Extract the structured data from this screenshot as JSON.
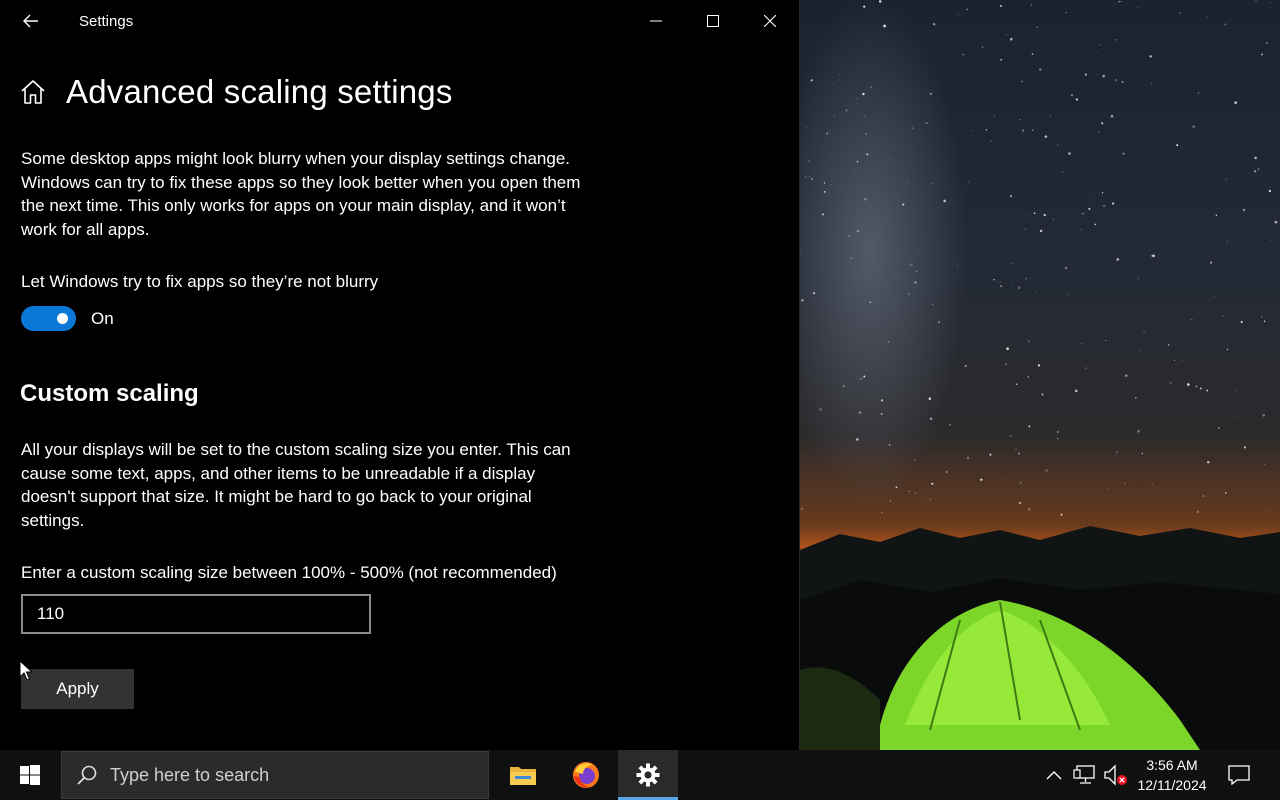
{
  "window": {
    "title": "Settings"
  },
  "page": {
    "title": "Advanced scaling settings",
    "intro": "Some desktop apps might look blurry when your display settings change. Windows can try to fix these apps so they look better when you open them the next time. This only works for apps on your main display, and it won’t work for all apps.",
    "fix_toggle": {
      "label": "Let Windows try to fix apps so they’re not blurry",
      "state_text": "On",
      "on": true
    },
    "custom_scaling": {
      "heading": "Custom scaling",
      "description": "All your displays will be set to the custom scaling size you enter. This can cause some text, apps, and other items to be unreadable if a display doesn't support that size. It might be hard to go back to your original settings.",
      "input_label": "Enter a custom scaling size between 100% - 500% (not recommended)",
      "input_value": "110",
      "apply_label": "Apply"
    }
  },
  "taskbar": {
    "search_placeholder": "Type here to search",
    "apps": [
      "file-explorer-icon",
      "firefox-icon",
      "settings-gear-icon"
    ],
    "active_app": "settings-gear-icon",
    "clock_time": "3:56 AM",
    "clock_date": "12/11/2024"
  },
  "colors": {
    "accent": "#0a78d7",
    "window_bg": "#000000",
    "button_bg": "#333333",
    "taskbar_bg": "#101010"
  }
}
